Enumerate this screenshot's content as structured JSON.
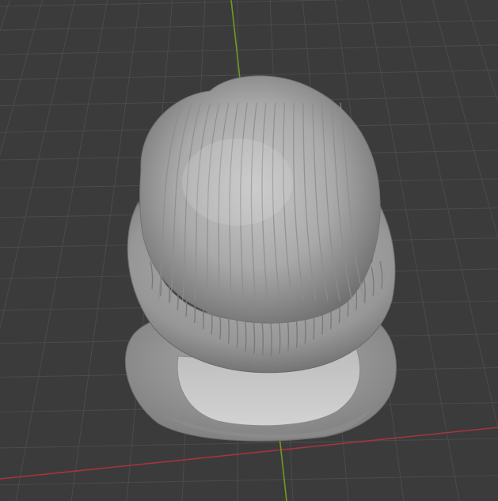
{
  "viewport": {
    "mode": "3D viewport",
    "background_color": "#3b3b3b",
    "grid_line_color": "#4a4a4a",
    "grid_line_minor_color": "#444444",
    "x_axis_color": "#b3363f",
    "y_axis_color": "#6e9a1e",
    "mesh_color": "#a8a8a8"
  },
  "object": {
    "icon": "sculpt-mesh-icon",
    "description_visible_text": ""
  }
}
